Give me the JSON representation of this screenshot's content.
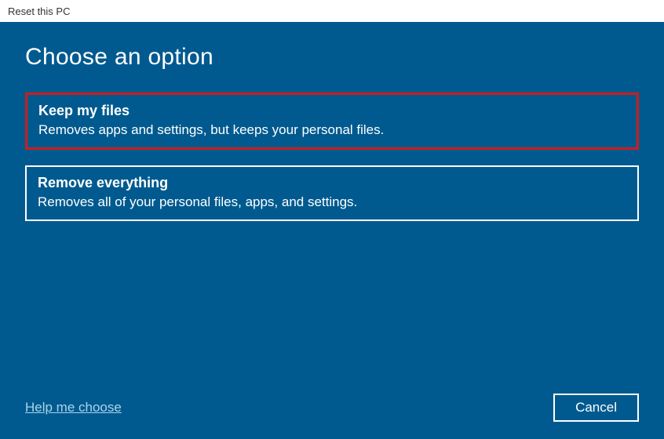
{
  "window": {
    "title": "Reset this PC"
  },
  "heading": "Choose an option",
  "options": [
    {
      "title": "Keep my files",
      "description": "Removes apps and settings, but keeps your personal files."
    },
    {
      "title": "Remove everything",
      "description": "Removes all of your personal files, apps, and settings."
    }
  ],
  "footer": {
    "help_label": "Help me choose",
    "cancel_label": "Cancel"
  }
}
